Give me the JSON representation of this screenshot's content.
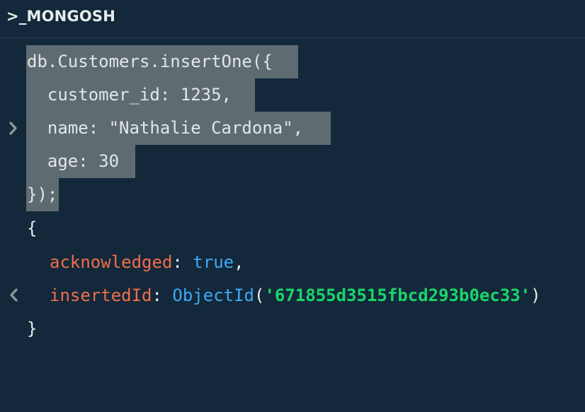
{
  "header": {
    "title": ">_MONGOSH"
  },
  "input": {
    "lines": [
      "db.Customers.insertOne({",
      "  customer_id: 1235,",
      "  name: \"Nathalie Cardona\",",
      "  age: 30",
      "});"
    ]
  },
  "output": {
    "open_brace": "{",
    "acknowledged_key": "acknowledged",
    "colon_1": ": ",
    "acknowledged_value": "true",
    "comma_1": ",",
    "insertedId_key": "insertedId",
    "colon_2": ": ",
    "objectid_fn": "ObjectId",
    "paren_open": "(",
    "objectid_value": "'671855d3515fbcd293b0ec33'",
    "paren_close": ")",
    "close_brace": "}"
  },
  "icons": {
    "input_prompt": "chevron-right-icon",
    "output_prompt": "chevron-left-icon"
  },
  "colors": {
    "background": "#13283a",
    "selection": "#5e6c72",
    "key": "#f16d4b",
    "keyword": "#3fa9f5",
    "string": "#18d66b"
  }
}
